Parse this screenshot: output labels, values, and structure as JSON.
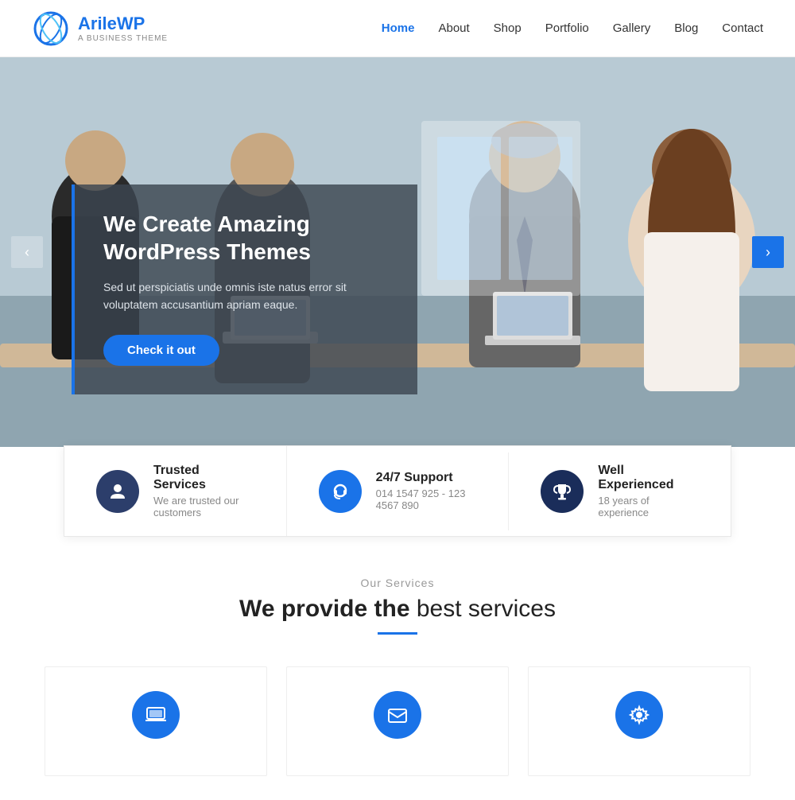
{
  "header": {
    "logo": {
      "name_part1": "Arile",
      "name_part2": "WP",
      "tagline": "A Business Theme"
    },
    "nav": {
      "items": [
        {
          "label": "Home",
          "active": true
        },
        {
          "label": "About",
          "active": false
        },
        {
          "label": "Shop",
          "active": false
        },
        {
          "label": "Portfolio",
          "active": false
        },
        {
          "label": "Gallery",
          "active": false
        },
        {
          "label": "Blog",
          "active": false
        },
        {
          "label": "Contact",
          "active": false
        }
      ]
    }
  },
  "hero": {
    "title": "We Create Amazing WordPress Themes",
    "description": "Sed ut perspiciatis unde omnis iste natus error sit voluptatem accusantium apriam eaque.",
    "cta_label": "Check it out",
    "prev_arrow": "‹",
    "next_arrow": "›"
  },
  "features": [
    {
      "icon": "person",
      "icon_unicode": "👤",
      "title": "Trusted Services",
      "description": "We are trusted our customers",
      "icon_style": "fi-dark"
    },
    {
      "icon": "headphone",
      "icon_unicode": "🎧",
      "title": "24/7 Support",
      "description": "014 1547 925 - 123 4567 890",
      "icon_style": "fi-blue"
    },
    {
      "icon": "trophy",
      "icon_unicode": "🏆",
      "title": "Well Experienced",
      "description": "18 years of experience",
      "icon_style": "fi-darkblue"
    }
  ],
  "services": {
    "label": "Our Services",
    "title_part1": "We provide the",
    "title_part2": "best services",
    "cards": [
      {
        "icon": "💻"
      },
      {
        "icon": "✉️"
      },
      {
        "icon": "⚙️"
      }
    ]
  }
}
